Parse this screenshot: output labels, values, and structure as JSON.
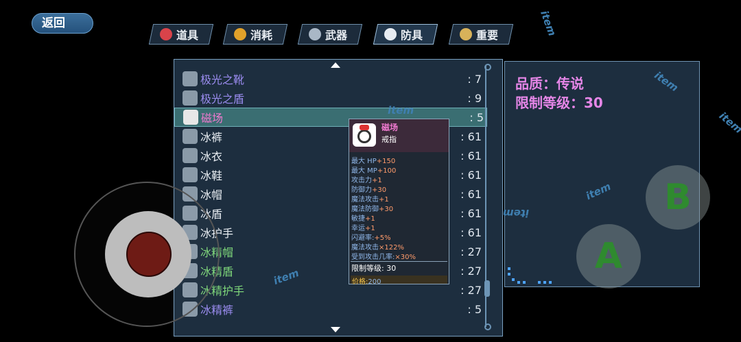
{
  "back_label": "返回",
  "tabs": [
    {
      "label": "道具",
      "icon": "potion-icon"
    },
    {
      "label": "消耗",
      "icon": "fruit-icon"
    },
    {
      "label": "武器",
      "icon": "sword-icon"
    },
    {
      "label": "防具",
      "icon": "armor-icon",
      "active": true
    },
    {
      "label": "重要",
      "icon": "magnifier-icon"
    }
  ],
  "items": [
    {
      "name": "极光之靴",
      "count": ": 7",
      "color": "#9b8cf0"
    },
    {
      "name": "极光之盾",
      "count": ": 9",
      "color": "#9b8cf0"
    },
    {
      "name": "磁场",
      "count": ": 5",
      "color": "#f07ad0",
      "selected": true
    },
    {
      "name": "冰裤",
      "count": ": 61",
      "color": "#e8edf2"
    },
    {
      "name": "冰衣",
      "count": ": 61",
      "color": "#e8edf2"
    },
    {
      "name": "冰鞋",
      "count": ": 61",
      "color": "#e8edf2"
    },
    {
      "name": "冰帽",
      "count": ": 61",
      "color": "#e8edf2"
    },
    {
      "name": "冰盾",
      "count": ": 61",
      "color": "#e8edf2"
    },
    {
      "name": "冰护手",
      "count": ": 61",
      "color": "#e8edf2"
    },
    {
      "name": "冰精帽",
      "count": ": 27",
      "color": "#7ed67a"
    },
    {
      "name": "冰精盾",
      "count": ": 27",
      "color": "#7ed67a"
    },
    {
      "name": "冰精护手",
      "count": ": 27",
      "color": "#7ed67a"
    },
    {
      "name": "冰精裤",
      "count": ": 5",
      "color": "#9b8cf0"
    }
  ],
  "detail": {
    "quality": "品质：传说",
    "level": "限制等级：30"
  },
  "tooltip": {
    "name": "磁场",
    "type": "戒指",
    "stats": [
      {
        "label": "最大 HP",
        "value": "+150"
      },
      {
        "label": "最大 MP",
        "value": "+100"
      },
      {
        "label": "攻击力",
        "value": "+1"
      },
      {
        "label": "防御力",
        "value": "+30"
      },
      {
        "label": "魔法攻击",
        "value": "+1"
      },
      {
        "label": "魔法防御",
        "value": "+30"
      },
      {
        "label": "敏捷",
        "value": "+1"
      },
      {
        "label": "幸运",
        "value": "+1"
      },
      {
        "label": "闪避率:",
        "value": "+5%"
      },
      {
        "label": "魔法攻击",
        "value": "×122%"
      },
      {
        "label": "受到攻击几率:",
        "value": "×30%"
      }
    ],
    "level": "限制等级: 30",
    "price_label": "价格:",
    "price": "200"
  },
  "watermark": "item",
  "buttons": {
    "a": "A",
    "b": "B"
  }
}
